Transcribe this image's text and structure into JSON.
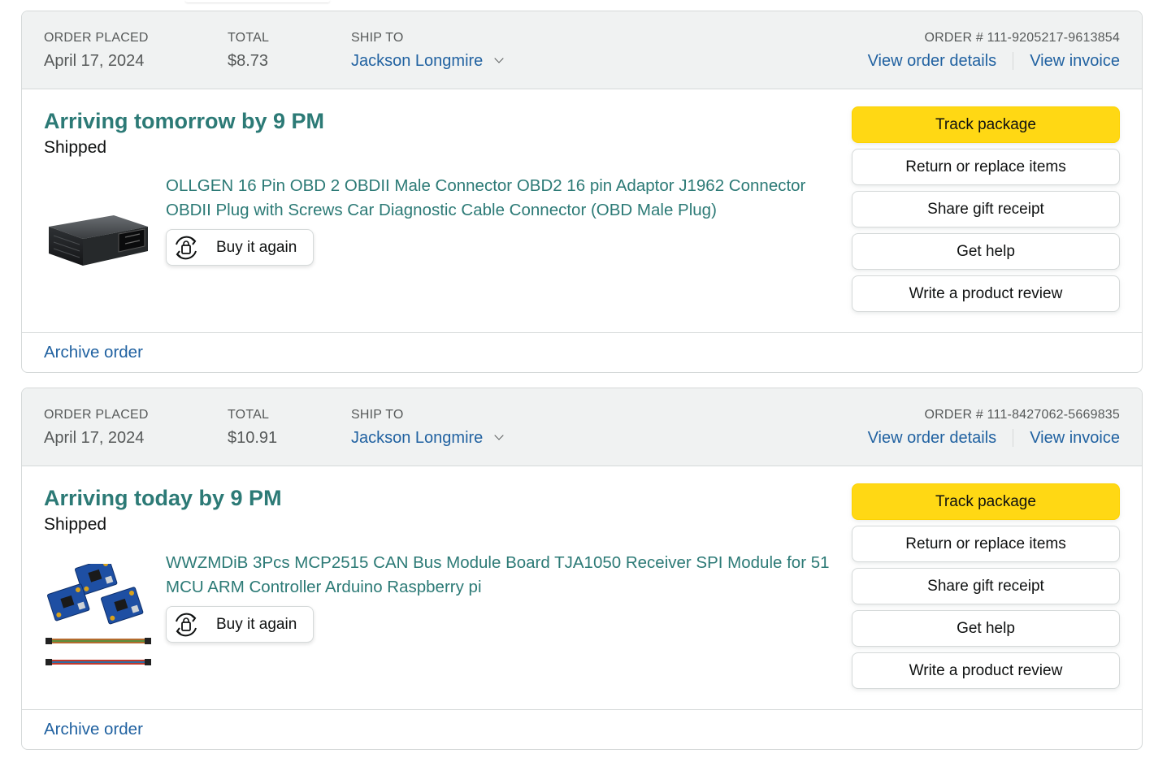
{
  "orders": [
    {
      "placed_label": "ORDER PLACED",
      "placed_date": "April 17, 2024",
      "total_label": "TOTAL",
      "total": "$8.73",
      "ship_to_label": "SHIP TO",
      "ship_to_name": "Jackson Longmire",
      "order_number": "ORDER # 111-9205217-9613854",
      "view_details": "View order details",
      "view_invoice": "View invoice",
      "arrival": "Arriving tomorrow by 9 PM",
      "status": "Shipped",
      "product_title": "OLLGEN 16 Pin OBD 2 OBDII Male Connector OBD2 16 pin Adaptor J1962 Connector OBDII Plug with Screws Car Diagnostic Cable Connector (OBD Male Plug)",
      "buy_again": "Buy it again",
      "actions": {
        "track": "Track package",
        "return": "Return or replace items",
        "gift": "Share gift receipt",
        "help": "Get help",
        "review": "Write a product review"
      },
      "archive": "Archive order"
    },
    {
      "placed_label": "ORDER PLACED",
      "placed_date": "April 17, 2024",
      "total_label": "TOTAL",
      "total": "$10.91",
      "ship_to_label": "SHIP TO",
      "ship_to_name": "Jackson Longmire",
      "order_number": "ORDER # 111-8427062-5669835",
      "view_details": "View order details",
      "view_invoice": "View invoice",
      "arrival": "Arriving today by 9 PM",
      "status": "Shipped",
      "product_title": "WWZMDiB 3Pcs MCP2515 CAN Bus Module Board TJA1050 Receiver SPI Module for 51 MCU ARM Controller Arduino Raspberry pi",
      "buy_again": "Buy it again",
      "actions": {
        "track": "Track package",
        "return": "Return or replace items",
        "gift": "Share gift receipt",
        "help": "Get help",
        "review": "Write a product review"
      },
      "archive": "Archive order"
    }
  ],
  "colors": {
    "arrival_green": "#2c7a76",
    "link_blue": "#2162a1",
    "primary_button": "#ffd814",
    "header_bg": "#f0f2f2"
  },
  "icons": {
    "buy_again": "buy-again-cycle-icon",
    "ship_to_dropdown": "chevron-down-icon"
  }
}
